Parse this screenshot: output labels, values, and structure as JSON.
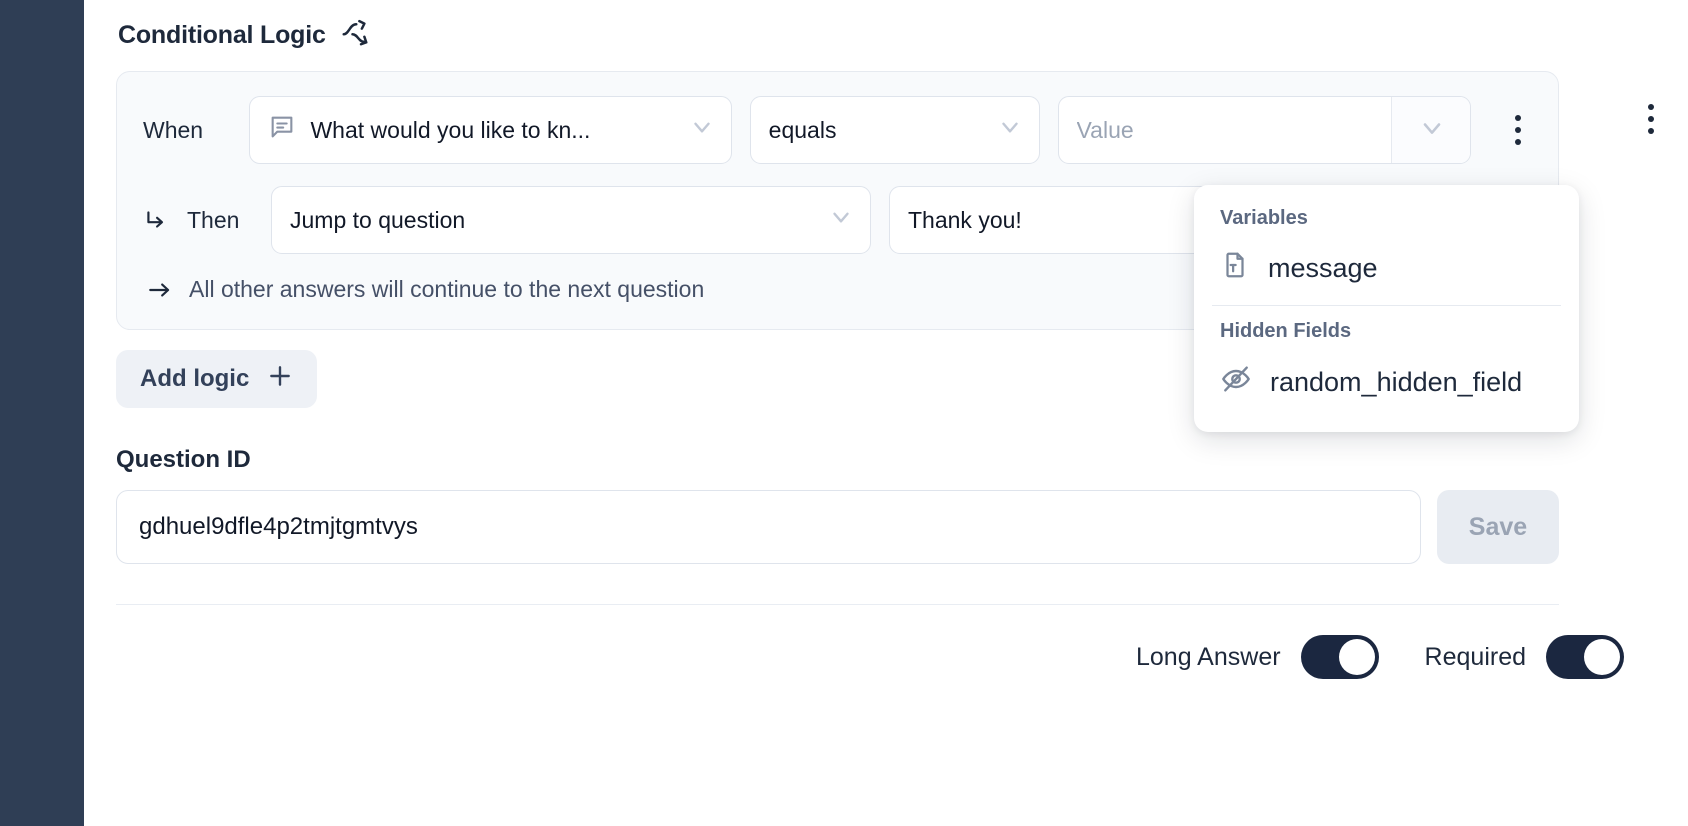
{
  "section": {
    "title": "Conditional Logic",
    "icon": "branch-logic-icon"
  },
  "logic": {
    "when_label": "When",
    "then_label": "Then",
    "question_select": {
      "value": "What would you like to kn...",
      "icon": "message-question-icon"
    },
    "operator_select": {
      "value": "equals"
    },
    "value_field": {
      "value": "",
      "placeholder": "Value"
    },
    "action_select": {
      "value": "Jump to question"
    },
    "target_select": {
      "value": "Thank you!"
    },
    "fallback_note": "All other answers will continue to the next question",
    "row_menu_label": "⋮",
    "card_menu_label": "⋮"
  },
  "add_logic": {
    "label": "Add logic",
    "icon": "plus-icon"
  },
  "question_id": {
    "label": "Question ID",
    "value": "gdhuel9dfle4p2tmjtgmtvys",
    "placeholder": "Question ID",
    "save_label": "Save"
  },
  "footer": {
    "long_answer_label": "Long Answer",
    "long_answer_state": "on",
    "required_label": "Required",
    "required_state": "on"
  },
  "popup": {
    "variables_header": "Variables",
    "variables": [
      {
        "label": "message",
        "icon": "file-text-icon"
      }
    ],
    "hidden_fields_header": "Hidden Fields",
    "hidden_fields": [
      {
        "label": "random_hidden_field",
        "icon": "eye-off-icon"
      }
    ]
  },
  "colors": {
    "rail": "#2f3e55",
    "text": "#1e293b",
    "muted": "#9aa4b4",
    "card_bg": "#f8fafc",
    "border": "#dfe4ec",
    "toggle_on": "#1b2740"
  }
}
